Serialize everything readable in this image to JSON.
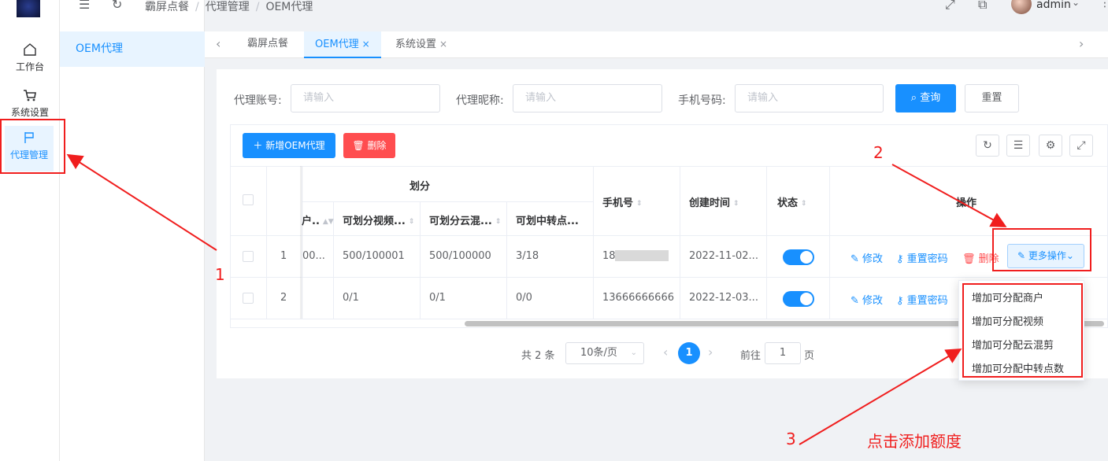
{
  "header": {
    "breadcrumb": [
      "霸屏点餐",
      "代理管理",
      "OEM代理"
    ],
    "user": "admin"
  },
  "leftnav": {
    "items": [
      {
        "label": "工作台",
        "icon": "home-icon"
      },
      {
        "label": "系统设置",
        "icon": "cart-icon"
      },
      {
        "label": "代理管理",
        "icon": "flag-icon"
      }
    ]
  },
  "submenu": {
    "items": [
      "OEM代理"
    ]
  },
  "tabs": [
    {
      "label": "霸屏点餐"
    },
    {
      "label": "OEM代理",
      "close": "×"
    },
    {
      "label": "系统设置",
      "close": "×"
    }
  ],
  "search": {
    "account_label": "代理账号:",
    "nickname_label": "代理昵称:",
    "phone_label": "手机号码:",
    "placeholder": "请输入",
    "query_btn": "查询",
    "reset_btn": "重置"
  },
  "toolbar": {
    "add_btn": "新增OEM代理",
    "delete_btn": "删除"
  },
  "table": {
    "group_header": "划分",
    "columns": {
      "merchant": "户..",
      "video": "可划分视频...",
      "cloud": "可划分云混...",
      "transfer": "可划中转点...",
      "phone": "手机号",
      "created": "创建时间",
      "status": "状态",
      "actions": "操作"
    },
    "rows": [
      {
        "index": "1",
        "merchant": "00...",
        "video": "500/100001",
        "cloud": "500/100000",
        "transfer": "3/18",
        "phone": "18",
        "created": "2022-11-02..."
      },
      {
        "index": "2",
        "merchant": "",
        "video": "0/1",
        "cloud": "0/1",
        "transfer": "0/0",
        "phone": "13666666666",
        "created": "2022-12-03..."
      }
    ],
    "action_edit": "修改",
    "action_reset": "重置密码",
    "action_delete": "删除",
    "action_more": "更多操作"
  },
  "dropdown": {
    "items": [
      "增加可分配商户",
      "增加可分配视频",
      "增加可分配云混剪",
      "增加可分配中转点数"
    ]
  },
  "pagination": {
    "total": "共 2 条",
    "page_size": "10条/页",
    "current": "1",
    "goto_label": "前往",
    "goto_value": "1",
    "page_suffix": "页"
  },
  "annotations": {
    "n1": "1",
    "n2": "2",
    "n3": "3",
    "caption": "点击添加额度"
  },
  "colors": {
    "primary": "#1890ff",
    "danger": "#ff4d4f",
    "annotation": "#f01e1e"
  }
}
